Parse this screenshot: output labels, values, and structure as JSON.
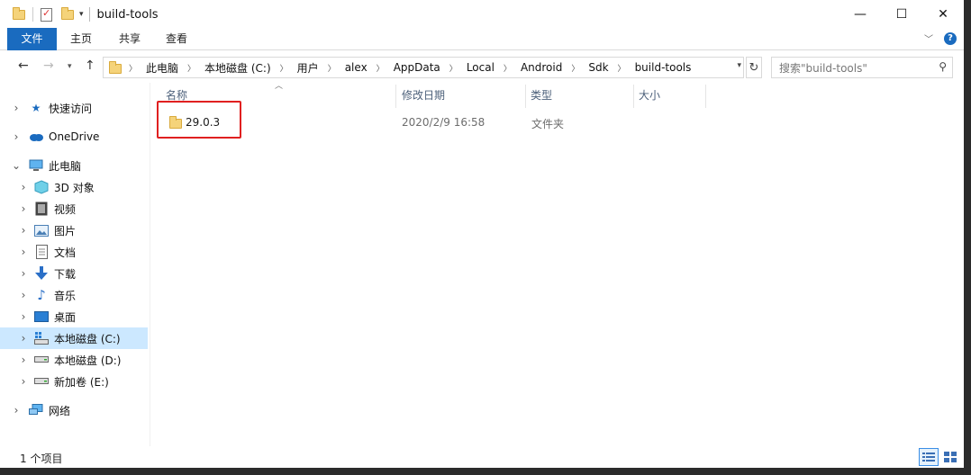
{
  "window": {
    "title": "build-tools",
    "minimize": "—",
    "maximize": "☐",
    "close": "✕"
  },
  "ribbon": {
    "tabs": [
      "文件",
      "主页",
      "共享",
      "查看"
    ]
  },
  "nav": {
    "breadcrumbs": [
      "此电脑",
      "本地磁盘 (C:)",
      "用户",
      "alex",
      "AppData",
      "Local",
      "Android",
      "Sdk",
      "build-tools"
    ],
    "search_placeholder": "搜索\"build-tools\""
  },
  "sidebar": {
    "items": [
      {
        "label": "快速访问",
        "icon": "star-icon"
      },
      {
        "label": "OneDrive",
        "icon": "cloud-icon"
      },
      {
        "label": "此电脑",
        "icon": "computer-icon"
      },
      {
        "label": "3D 对象",
        "icon": "cube-icon"
      },
      {
        "label": "视频",
        "icon": "film-icon"
      },
      {
        "label": "图片",
        "icon": "picture-icon"
      },
      {
        "label": "文档",
        "icon": "document-icon"
      },
      {
        "label": "下载",
        "icon": "download-icon"
      },
      {
        "label": "音乐",
        "icon": "music-icon"
      },
      {
        "label": "桌面",
        "icon": "desktop-icon"
      },
      {
        "label": "本地磁盘 (C:)",
        "icon": "drive-c-icon"
      },
      {
        "label": "本地磁盘 (D:)",
        "icon": "drive-icon"
      },
      {
        "label": "新加卷 (E:)",
        "icon": "drive-icon"
      },
      {
        "label": "网络",
        "icon": "network-icon"
      }
    ]
  },
  "content": {
    "columns": [
      "名称",
      "修改日期",
      "类型",
      "大小"
    ],
    "rows": [
      {
        "name": "29.0.3",
        "modified": "2020/2/9 16:58",
        "type": "文件夹",
        "size": ""
      }
    ]
  },
  "status": {
    "item_count": "1 个项目"
  },
  "colors": {
    "accent": "#1a6bbf",
    "selection": "#cce8ff",
    "highlight": "#e02020",
    "folder": "#f5d37a"
  }
}
